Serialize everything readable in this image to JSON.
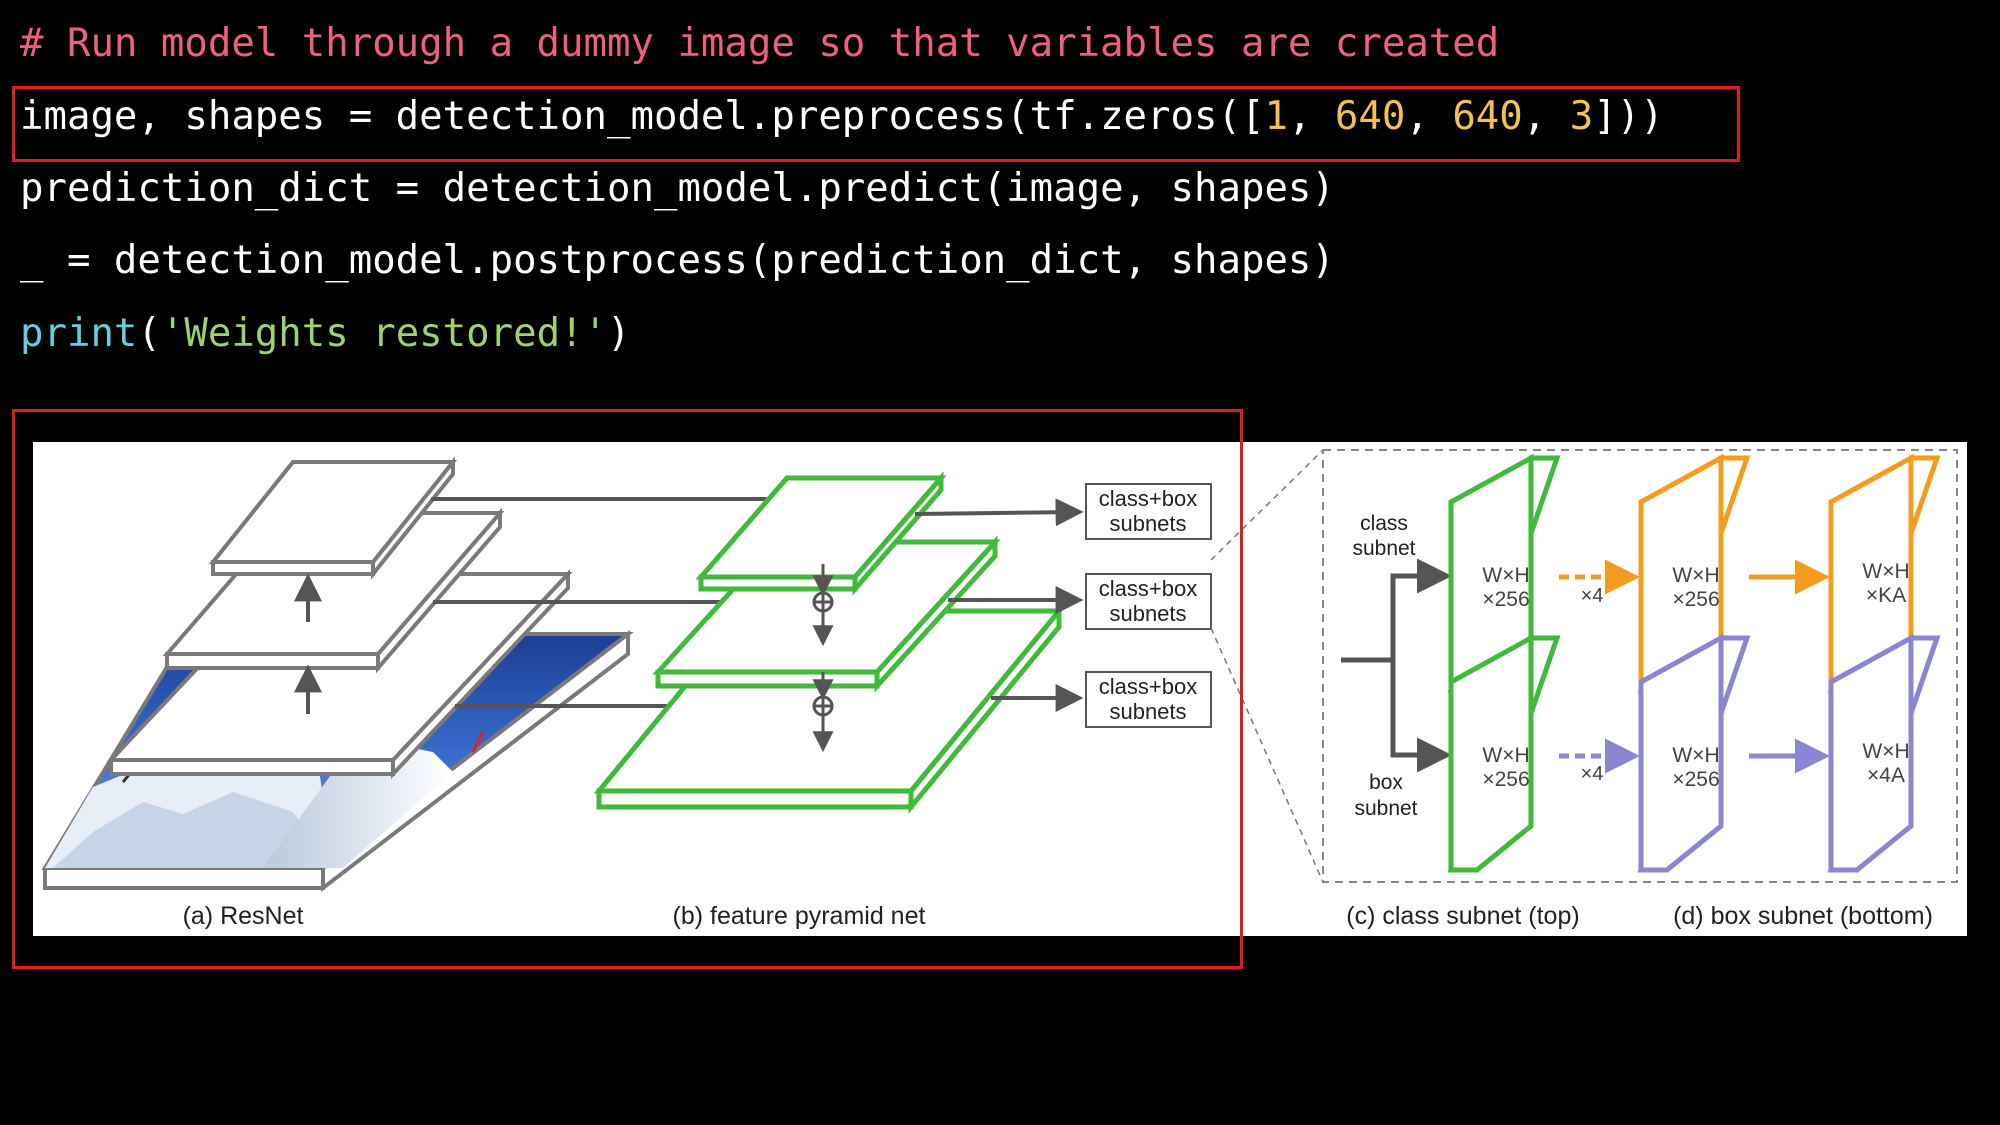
{
  "code": {
    "comment": "# Run model through a dummy image so that variables are created",
    "line1": {
      "pre": "image, shapes = detection_model.preprocess(tf.zeros([",
      "n1": "1",
      "sep1": ", ",
      "n2": "640",
      "sep2": ", ",
      "n3": "640",
      "sep3": ", ",
      "n4": "3",
      "post": "]))"
    },
    "line2": "prediction_dict = detection_model.predict(image, shapes)",
    "line3": "_ = detection_model.postprocess(prediction_dict, shapes)",
    "line4": {
      "fn": "print",
      "open": "(",
      "str": "'Weights restored!'",
      "close": ")"
    }
  },
  "diagram": {
    "subnet_label_line1": "class+box",
    "subnet_label_line2": "subnets",
    "class_subnet_line1": "class",
    "class_subnet_line2": "subnet",
    "box_subnet_line1": "box",
    "box_subnet_line2": "subnet",
    "feature_line1": "W×H",
    "feature_256": "×256",
    "feature_KA": "×KA",
    "feature_4A": "×4A",
    "repeat_label": "×4",
    "caption_a": "(a) ResNet",
    "caption_b": "(b) feature pyramid net",
    "caption_c": "(c) class subnet (top)",
    "caption_d": "(d) box subnet (bottom)"
  },
  "colors": {
    "background": "#000000",
    "highlight": "#e11b22",
    "pyramid_green": "#3fba3a",
    "class_orange": "#f39c1f",
    "box_purple": "#8a86d2",
    "resnet_gray": "#7a7a7a"
  }
}
